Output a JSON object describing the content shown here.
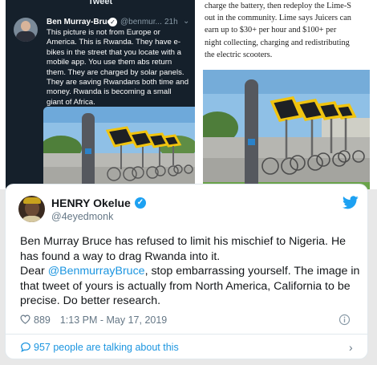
{
  "embedded_tweet": {
    "header_title": "Tweet",
    "author_name": "Ben Murray-Bruce",
    "author_handle": "@benmur...",
    "time": "21h",
    "text": "This picture is not from Europe or\nAmerica. This is Rwanda. They have e-\nbikes in the street that you locate with a\nmobile app. You use them abs return\nthem. They are charged by solar panels.\nThey are saving Rwandans both time and\nmoney. Rwanda is becoming a small\ngiant of Africa."
  },
  "article": {
    "text": "charge the battery, then redeploy the Lime-S\nout in the community. Lime says Juicers can\nearn up to $30+ per hour and $100+ per\nnight collecting, charging and redistributing\nthe electric scooters."
  },
  "tweet": {
    "name": "HENRY Okelue",
    "handle": "@4eyedmonk",
    "line1": "Ben Murray Bruce has refused to limit his mischief to Nigeria. He has found a way to drag Rwanda into it.",
    "dear": "Dear ",
    "mention": "@BenmurrayBruce",
    "rest": ", stop embarrassing yourself. The image in that tweet of yours is actually from North America, California to be precise. Do better research.",
    "likes": "889",
    "timestamp": "1:13 PM - May 17, 2019",
    "talking": "957 people are talking about this"
  },
  "colors": {
    "twitter_blue": "#1da1f2",
    "link_blue": "#1b95e0",
    "dark_bg": "#15202b",
    "muted": "#657786"
  },
  "icons": [
    "verified-icon",
    "twitter-bird-icon",
    "heart-icon",
    "info-icon",
    "speech-bubble-icon",
    "chevron-right-icon"
  ]
}
